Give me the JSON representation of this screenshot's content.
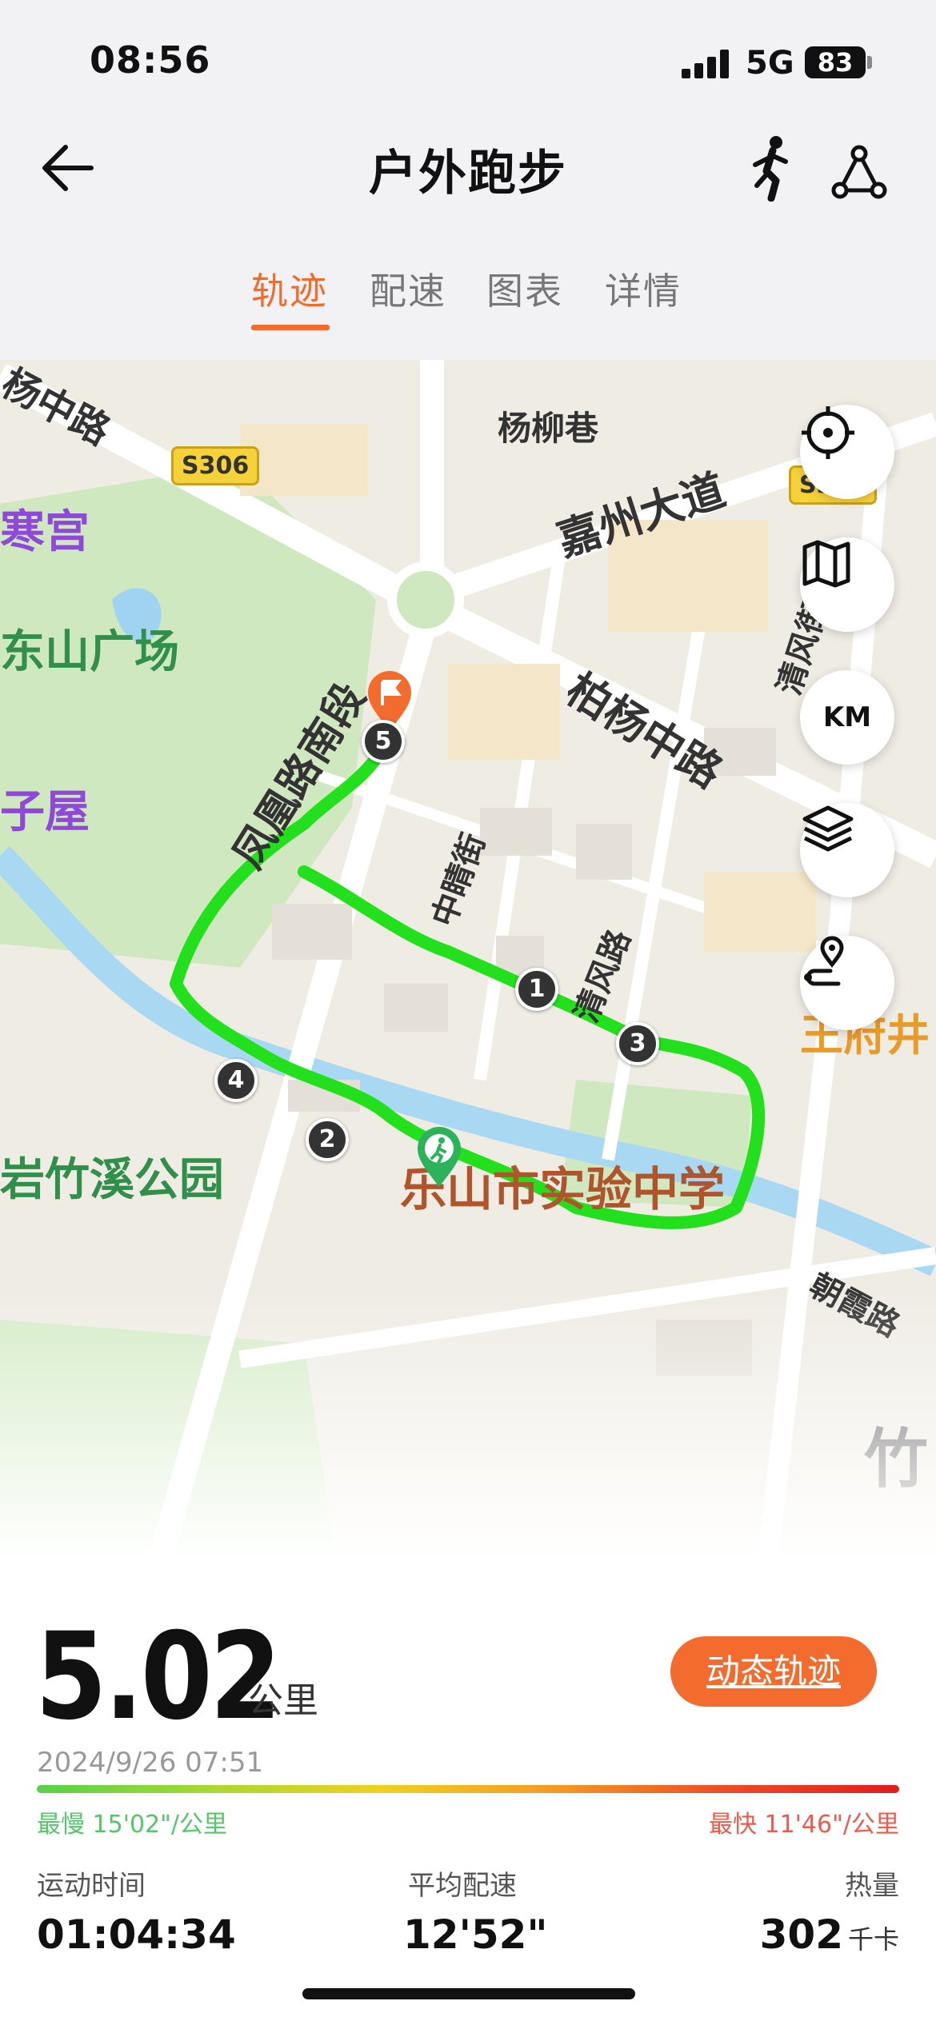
{
  "status_bar": {
    "time": "08:56",
    "network": "5G",
    "battery": "83"
  },
  "header": {
    "title": "户外跑步",
    "icons": [
      "back-arrow-icon",
      "runner-icon",
      "route-icon"
    ]
  },
  "tabs": [
    {
      "label": "轨迹",
      "active": true
    },
    {
      "label": "配速",
      "active": false
    },
    {
      "label": "图表",
      "active": false
    },
    {
      "label": "详情",
      "active": false
    }
  ],
  "map": {
    "labels": {
      "yangzhong": "杨中路",
      "yangliuxiang": "杨柳巷",
      "jiazhou": "嘉州大道",
      "hangong": "寒宫",
      "dongshan": "东山广场",
      "baiyang": "柏杨中路",
      "qingfeng_top": "清风街",
      "fenghuang": "凤凰路南段",
      "ziwu": "子屋",
      "zhongqing": "中睛街",
      "qingfeng_road": "清风路",
      "wangfu": "王府井",
      "zhuxi": "岩竹溪公园",
      "school": "乐山市实验中学",
      "zhaoxia": "朝霞路",
      "zhu": "竹"
    },
    "road_badges": [
      "S306",
      "S306"
    ],
    "km_markers": [
      "1",
      "2",
      "3",
      "4",
      "5"
    ],
    "controls": [
      {
        "name": "locate",
        "icon": "crosshair-icon"
      },
      {
        "name": "map-type",
        "icon": "map-icon"
      },
      {
        "name": "km-toggle",
        "label": "KM"
      },
      {
        "name": "layers",
        "icon": "layers-icon"
      },
      {
        "name": "route-replay",
        "icon": "route-pin-icon"
      }
    ],
    "route_color": "#22e01c"
  },
  "summary": {
    "distance": "5.02",
    "distance_unit": "公里",
    "dynamic_button": "动态轨迹",
    "datetime": "2024/9/26 07:51",
    "slowest": "最慢 15'02\"/公里",
    "fastest": "最快 11'46\"/公里",
    "stats": [
      {
        "label": "运动时间",
        "value": "01:04:34",
        "unit": ""
      },
      {
        "label": "平均配速",
        "value": "12'52\"",
        "unit": ""
      },
      {
        "label": "热量",
        "value": "302",
        "unit": "千卡"
      }
    ]
  },
  "colors": {
    "accent": "#f36b2d",
    "slow": "#57c56a",
    "fast": "#ef5a4a"
  }
}
